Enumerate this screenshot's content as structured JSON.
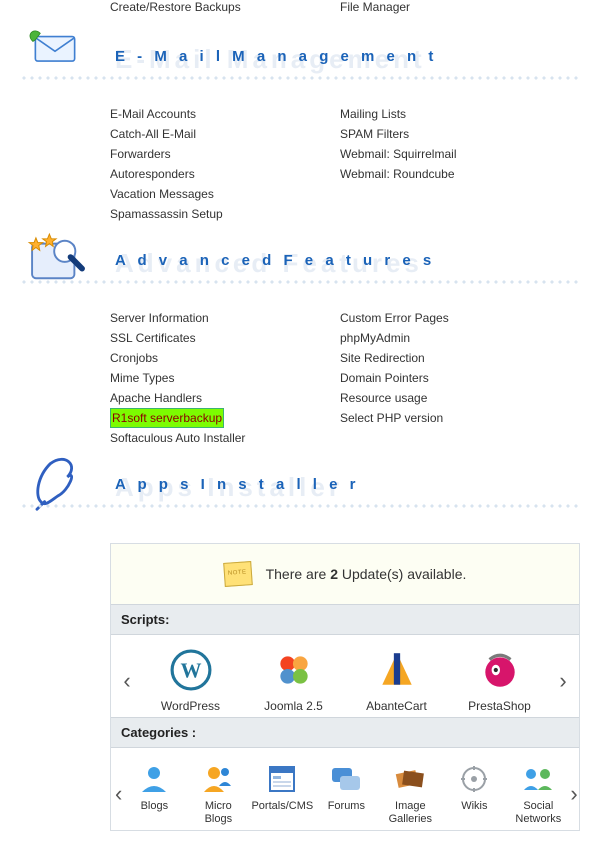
{
  "toprow": {
    "left": "Create/Restore Backups",
    "right": "File Manager"
  },
  "sections": {
    "email": {
      "shadow": "E-Mail Management",
      "title": "E - M a i l   M a n a g e m e n t",
      "left": [
        "E-Mail Accounts",
        "Catch-All E-Mail",
        "Forwarders",
        "Autoresponders",
        "Vacation Messages",
        "Spamassassin Setup"
      ],
      "right": [
        "Mailing Lists",
        "SPAM Filters",
        "Webmail: Squirrelmail",
        "Webmail: Roundcube"
      ]
    },
    "advanced": {
      "shadow": "Advanced Features",
      "title": "A d v a n c e d   F e a t u r e s",
      "left": [
        "Server Information",
        "SSL Certificates",
        "Cronjobs",
        "Mime Types",
        "Apache Handlers",
        "R1soft serverbackup",
        "Softaculous Auto Installer"
      ],
      "left_highlight_index": 5,
      "right": [
        "Custom Error Pages",
        "phpMyAdmin",
        "Site Redirection",
        "Domain Pointers",
        "Resource usage",
        "Select PHP version"
      ]
    },
    "apps": {
      "shadow": "Apps Installer",
      "title": "A p p s   I n s t a l l e r",
      "notice_pre": "There are ",
      "notice_bold": "2",
      "notice_post": " Update(s) available.",
      "scripts_heading": "Scripts:",
      "scripts": [
        "WordPress",
        "Joomla 2.5",
        "AbanteCart",
        "PrestaShop"
      ],
      "categories_heading": "Categories :",
      "categories": [
        "Blogs",
        "Micro Blogs",
        "Portals/CMS",
        "Forums",
        "Image Galleries",
        "Wikis",
        "Social Networks"
      ]
    }
  }
}
